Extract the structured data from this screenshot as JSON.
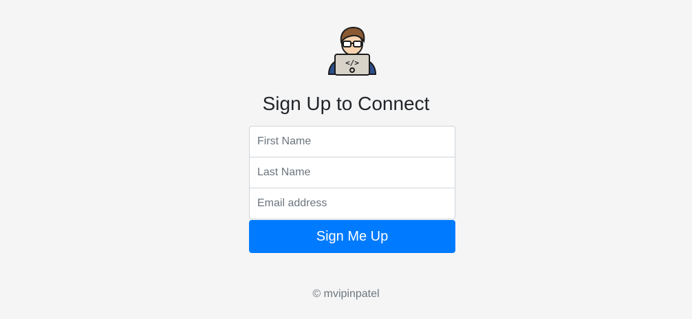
{
  "logo": {
    "icon": "developer-avatar-icon"
  },
  "heading": "Sign Up to Connect",
  "form": {
    "first_name_placeholder": "First Name",
    "last_name_placeholder": "Last Name",
    "email_placeholder": "Email address",
    "submit_label": "Sign Me Up"
  },
  "footer": {
    "copyright": "© mvipinpatel"
  },
  "colors": {
    "background": "#f5f5f5",
    "primary_button": "#007bff",
    "text": "#212529",
    "muted_text": "#6c757d",
    "input_border": "#ced4da"
  }
}
